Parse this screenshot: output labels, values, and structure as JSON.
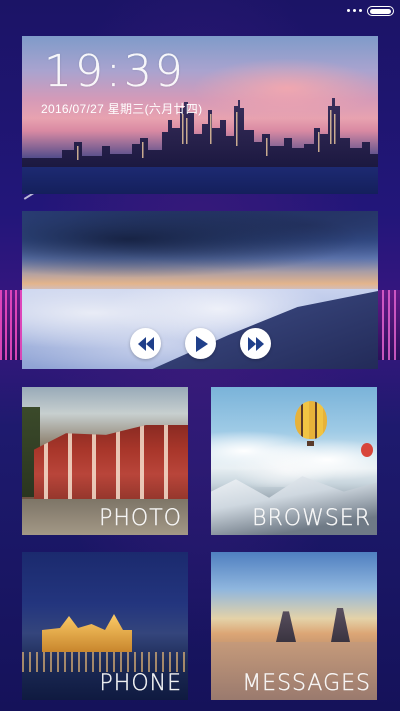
{
  "status_bar": {
    "more_icon": "more-dots-icon",
    "battery_icon": "battery-icon"
  },
  "clock": {
    "time": "19:39",
    "date": "2016/07/27  星期三(六月廿四)"
  },
  "music": {
    "controls": [
      {
        "name": "previous",
        "icon": "rewind-icon"
      },
      {
        "name": "play",
        "icon": "play-icon"
      },
      {
        "name": "next",
        "icon": "fast-forward-icon"
      }
    ]
  },
  "apps": [
    {
      "id": "photo",
      "label": "PHOTO"
    },
    {
      "id": "browser",
      "label": "BROWSER"
    },
    {
      "id": "phone",
      "label": "PHONE"
    },
    {
      "id": "messages",
      "label": "MESSAGES"
    }
  ],
  "colors": {
    "background": "#1b1466",
    "accent": "#3a1680",
    "control_fill": "#ffffff",
    "control_icon": "#1f3f8a"
  }
}
